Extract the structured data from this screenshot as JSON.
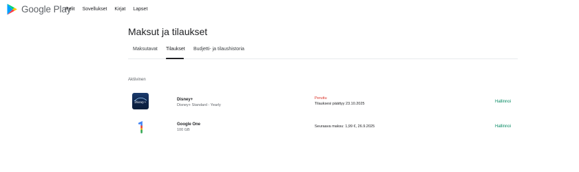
{
  "header": {
    "logo_text": "Google Play",
    "nav": [
      "Pelit",
      "Sovellukset",
      "Kirjat",
      "Lapset"
    ]
  },
  "page": {
    "title": "Maksut ja tilaukset",
    "tabs": [
      "Maksutavat",
      "Tilaukset",
      "Budjetti- ja tilaushistoria"
    ],
    "active_tab": "Tilaukset",
    "section_label": "Aktiivinen"
  },
  "subscriptions": [
    {
      "name": "Disney+",
      "subtitle": "Disney+ Standard - Yearly",
      "status": "Peruttu",
      "detail": "Tilauksesi päättyy 23.10.2025",
      "action": "Hallinnoi",
      "icon": "disney-plus-icon",
      "icon_text": "Disney+"
    },
    {
      "name": "Google One",
      "subtitle": "100 GB",
      "status": "",
      "detail": "Seuraava maksu: 1,99 €, 26.9.2025",
      "action": "Hallinnoi",
      "icon": "google-one-icon"
    }
  ],
  "colors": {
    "accent": "#01875f",
    "cancelled": "#d93025",
    "disney_bg": "#0d2347"
  }
}
